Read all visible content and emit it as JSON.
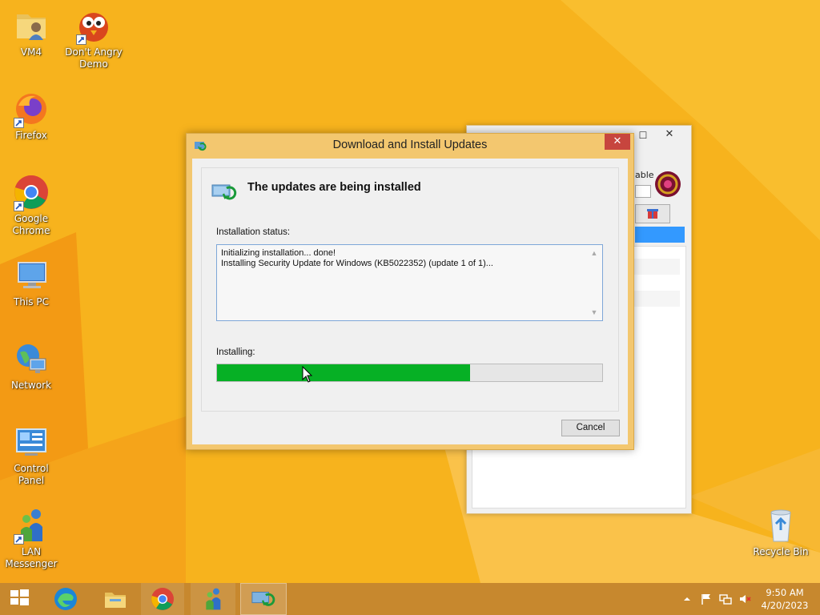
{
  "desktop": {
    "icons": [
      {
        "label": "VM4"
      },
      {
        "label": "Don't Angry Demo"
      },
      {
        "label": "Firefox"
      },
      {
        "label": "Google Chrome"
      },
      {
        "label": "This PC"
      },
      {
        "label": "Network"
      },
      {
        "label": "Control Panel"
      },
      {
        "label": "LAN Messenger"
      },
      {
        "label": "Recycle Bin"
      }
    ]
  },
  "background_window": {
    "label_fragment": "able",
    "maximize_glyph": "☐",
    "close_glyph": "✕"
  },
  "dialog": {
    "title": "Download and Install Updates",
    "close_glyph": "✕",
    "header": "The updates are being installed",
    "status_label": "Installation status:",
    "status_lines": [
      "Initializing installation... done!",
      "Installing Security Update for Windows (KB5022352) (update 1 of 1)..."
    ],
    "progress_label": "Installing:",
    "progress_fraction": 0.657,
    "cancel_label": "Cancel"
  },
  "taskbar": {
    "buttons": [
      "start-icon",
      "edge-icon",
      "file-explorer-icon",
      "chrome-icon",
      "lan-messenger-icon",
      "windows-update-icon"
    ],
    "active": "windows-update-icon",
    "tray_icons": [
      "show-hidden-icons-icon",
      "action-center-flag-icon",
      "network-icon",
      "volume-muted-icon"
    ],
    "clock_time": "9:50 AM",
    "clock_date": "4/20/2023"
  },
  "colors": {
    "wallpaper_orange": "#f7b31d",
    "dialog_frame": "#f3c76f",
    "progress_green": "#06b025",
    "close_red": "#c7453e",
    "taskbar": "#c7882e"
  }
}
